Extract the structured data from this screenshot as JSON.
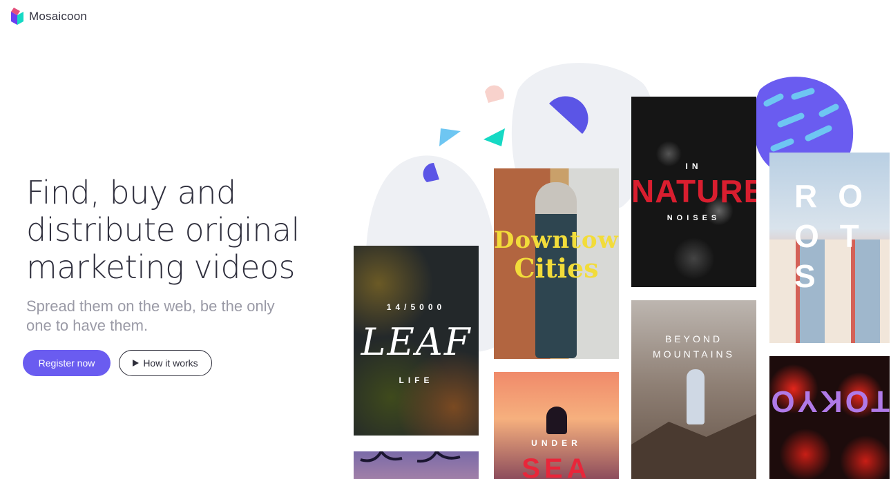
{
  "header": {
    "brand": "Mosaicoon"
  },
  "hero": {
    "title_line1": "Find, buy and",
    "title_line2": "distribute original",
    "title_line3": "marketing videos",
    "subtitle_line1": "Spread them on the web, be the only",
    "subtitle_line2": "one to have them."
  },
  "actions": {
    "register_label": "Register now",
    "how_label": "How it works"
  },
  "cards": {
    "leaf": {
      "top": "14/5000",
      "main": "LEAF",
      "bottom": "LIFE"
    },
    "downtown": {
      "line1": "Downtown",
      "line2": "Cities"
    },
    "nature": {
      "top": "IN",
      "main": "NATURE",
      "bottom": "NOISES"
    },
    "roots": {
      "letters": "ROOTS"
    },
    "beyond": {
      "line1": "BEYOND",
      "line2": "MOUNTAINS"
    },
    "under": {
      "top": "UNDER",
      "main": "SEA"
    },
    "tokyo": {
      "main": "TOKYO"
    }
  },
  "colors": {
    "accent": "#6a5cf0",
    "text": "#2f2f3d",
    "muted": "#9a9aa6",
    "teal": "#16d9c4",
    "sky": "#6ec6f2",
    "pink": "#f8d2cc"
  }
}
